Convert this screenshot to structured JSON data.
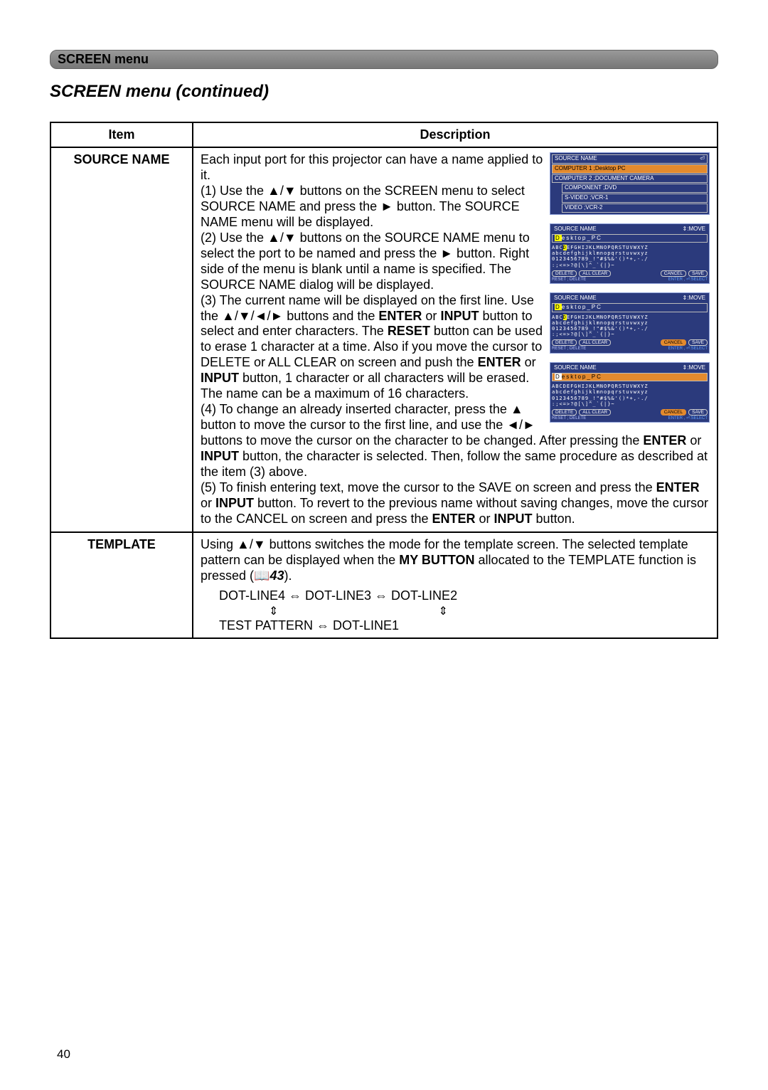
{
  "menu_bar_label": "SCREEN menu",
  "section_title": "SCREEN menu (continued)",
  "table": {
    "head_item": "Item",
    "head_desc": "Description"
  },
  "source_name": {
    "label": "SOURCE NAME",
    "intro": "Each input port for this projector can have a name applied to it.",
    "s1a": "(1) Use the ▲/▼ buttons on the SCREEN menu to select SOURCE NAME and press the ► button. The SOURCE NAME menu will be displayed.",
    "s2": "(2) Use the ▲/▼ buttons on the SOURCE NAME menu to select the port to be named and press the ► button. Right side of the menu is blank until a name is specified. The SOURCE NAME dialog will be displayed.",
    "s3": "(3) The current name will be displayed on the first line. Use the ▲/▼/◄/► buttons and the ENTER or INPUT button to select and enter characters. The RESET button can be used to erase 1 character at a time. Also if you move the cursor to DELETE or ALL CLEAR on screen and push the ENTER or INPUT button, 1 character or all characters will be erased. The name can be a maximum of 16 characters.",
    "s4": "(4) To change an already inserted character, press the ▲ button to move the cursor to the first line, and use the ◄/► buttons to move the cursor on the character to be changed. After pressing the ENTER or INPUT button, the character is selected. Then, follow the same procedure as described at the item (3) above.",
    "s5": "(5) To finish entering text, move the cursor to the SAVE on screen and press the ENTER or INPUT button. To revert to the previous name without saving changes, move the cursor to the CANCEL on screen and press the ENTER or INPUT button.",
    "tokens": {
      "enter": "ENTER",
      "input": "INPUT",
      "reset": "RESET"
    }
  },
  "template": {
    "label": "TEMPLATE",
    "desc_1": "Using ▲/▼ buttons switches the mode for the template screen. The selected template pattern can be displayed when the ",
    "my_button": "MY BUTTON",
    "desc_2": " allocated to the TEMPLATE function is pressed (",
    "ref_icon": "📖",
    "ref_num": "43",
    "desc_3": ").",
    "flow_line1": "DOT-LINE4 ⇔ DOT-LINE3 ⇔ DOT-LINE2",
    "flow_line2": "TEST PATTERN  ⇔  DOT-LINE1"
  },
  "mini": {
    "source_menu": {
      "title": "SOURCE NAME",
      "rows": [
        "COMPUTER 1 ;Desktop PC",
        "COMPUTER 2 ;DOCUMENT CAMERA",
        "COMPONENT ;DVD",
        "S-VIDEO ;VCR-1",
        "VIDEO ;VCR-2"
      ]
    },
    "editor": {
      "title": "SOURCE NAME",
      "move": "⇕:MOVE",
      "input": "Desktop_PC",
      "chars1": "ABCDEFGHIJKLMNOPQRSTUVWXYZ",
      "chars2": "abcdefghijklmnopqrstuvwxyz",
      "chars3": "0123456789_!\"#$%&'()*+,-./",
      "chars4": ":;<=>?@[\\]^_`{|}~",
      "btns": {
        "delete": "DELETE",
        "allclear": "ALL CLEAR",
        "cancel": "CANCEL",
        "save": "SAVE"
      },
      "footer_left": "RESET ; DELETE",
      "footer_right": "ENTER , ⏎:SELECT"
    }
  },
  "page_number": "40"
}
